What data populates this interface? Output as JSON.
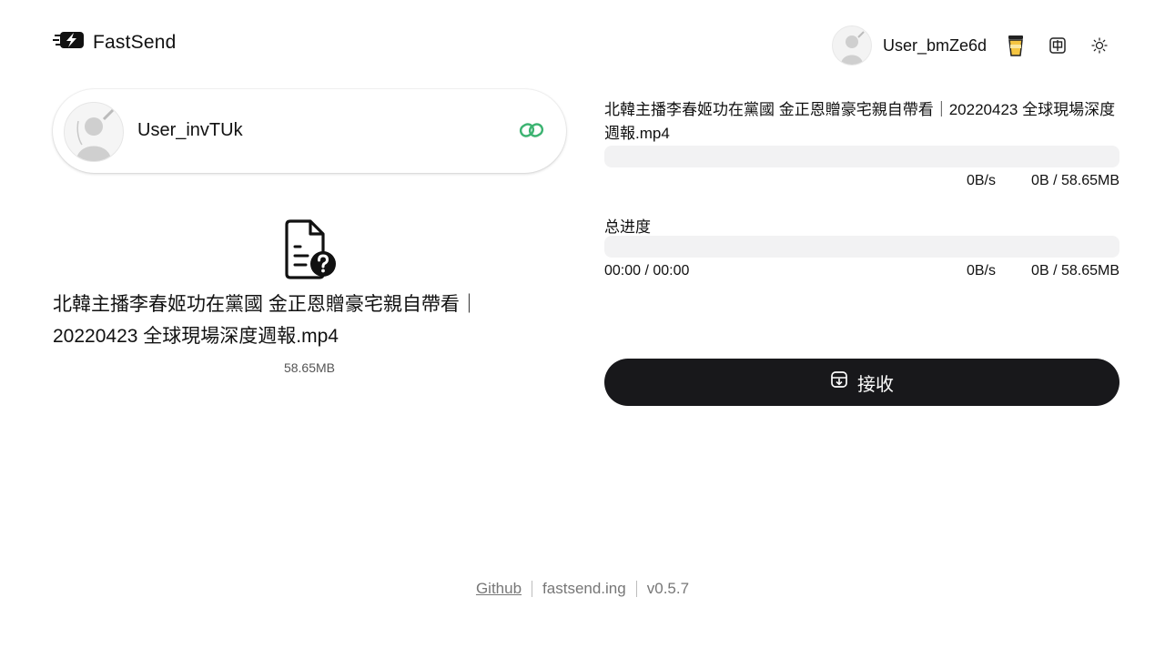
{
  "app": {
    "name": "FastSend"
  },
  "header": {
    "me_name": "User_bmZe6d",
    "icons": [
      "coffee-cup-icon",
      "language-toggle-icon",
      "theme-sun-icon"
    ],
    "language_glyph": "中"
  },
  "peer": {
    "name": "User_invTUk",
    "status_icon": "link-icon",
    "status_color": "#3cb371"
  },
  "file": {
    "icon": "file-question-icon",
    "name": "北韓主播李春姬功在黨國 金正恩贈豪宅親自帶看｜20220423 全球現場深度週報.mp4",
    "size": "58.65MB"
  },
  "transfer": {
    "filename": "北韓主播李春姬功在黨國 金正恩贈豪宅親自帶看｜20220423 全球現場深度週報.mp4",
    "file_progress_fraction": 0,
    "file_speed": "0B/s",
    "file_bytes": "0B / 58.65MB",
    "total_label": "总进度",
    "total_progress_fraction": 0,
    "total_time": "00:00 / 00:00",
    "total_speed": "0B/s",
    "total_bytes": "0B / 58.65MB"
  },
  "actions": {
    "receive_label": "接收",
    "receive_icon": "download-tray-icon"
  },
  "footer": {
    "github": "Github",
    "site": "fastsend.ing",
    "version": "v0.5.7"
  },
  "colors": {
    "primary_dark": "#18181b",
    "track": "#f2f2f3",
    "link_green": "#3cb371"
  }
}
